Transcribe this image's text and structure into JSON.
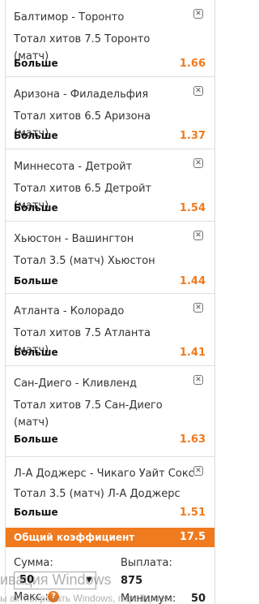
{
  "bets": [
    {
      "match": "Балтимор - Торонто",
      "market": "Тотал хитов 7.5 Торонто (матч)",
      "selection": "Больше",
      "odds": "1.66"
    },
    {
      "match": "Аризона - Филадельфия",
      "market": "Тотал хитов 6.5 Аризона (матч)",
      "selection": "Больше",
      "odds": "1.37"
    },
    {
      "match": "Миннесота - Детройт",
      "market": "Тотал хитов 6.5 Детройт (матч)",
      "selection": "Больше",
      "odds": "1.54"
    },
    {
      "match": "Хьюстон - Вашингтон",
      "market": "Тотал 3.5 (матч) Хьюстон",
      "selection": "Больше",
      "odds": "1.44"
    },
    {
      "match": "Атланта - Колорадо",
      "market": "Тотал хитов 7.5 Атланта (матч)",
      "selection": "Больше",
      "odds": "1.41"
    },
    {
      "match": "Сан-Диего - Кливленд",
      "market": "Тотал хитов 7.5 Сан-Диего (матч)",
      "selection": "Больше",
      "odds": "1.63"
    },
    {
      "match": "Л-А Доджерс - Чикаго Уайт Сокс",
      "market": "Тотал 3.5 (матч) Л-А Доджерс",
      "selection": "Больше",
      "odds": "1.51"
    }
  ],
  "total": {
    "label": "Общий коэффициент",
    "value": "17.5"
  },
  "footer": {
    "stake_label": "Сумма:",
    "stake_value": "50",
    "payout_label": "Выплата:",
    "payout_value": "875",
    "max_label": "Макс.:",
    "min_label": "Минимум:",
    "min_value": "50"
  },
  "watermark": {
    "line1": "ивация Windows",
    "line2": "ы активировать Windows, перейдите"
  },
  "icons": {
    "close": "close-icon",
    "help": "help-icon",
    "dropdown": "chevron-down-icon"
  },
  "colors": {
    "accent": "#f07a1e",
    "text": "#333333"
  }
}
